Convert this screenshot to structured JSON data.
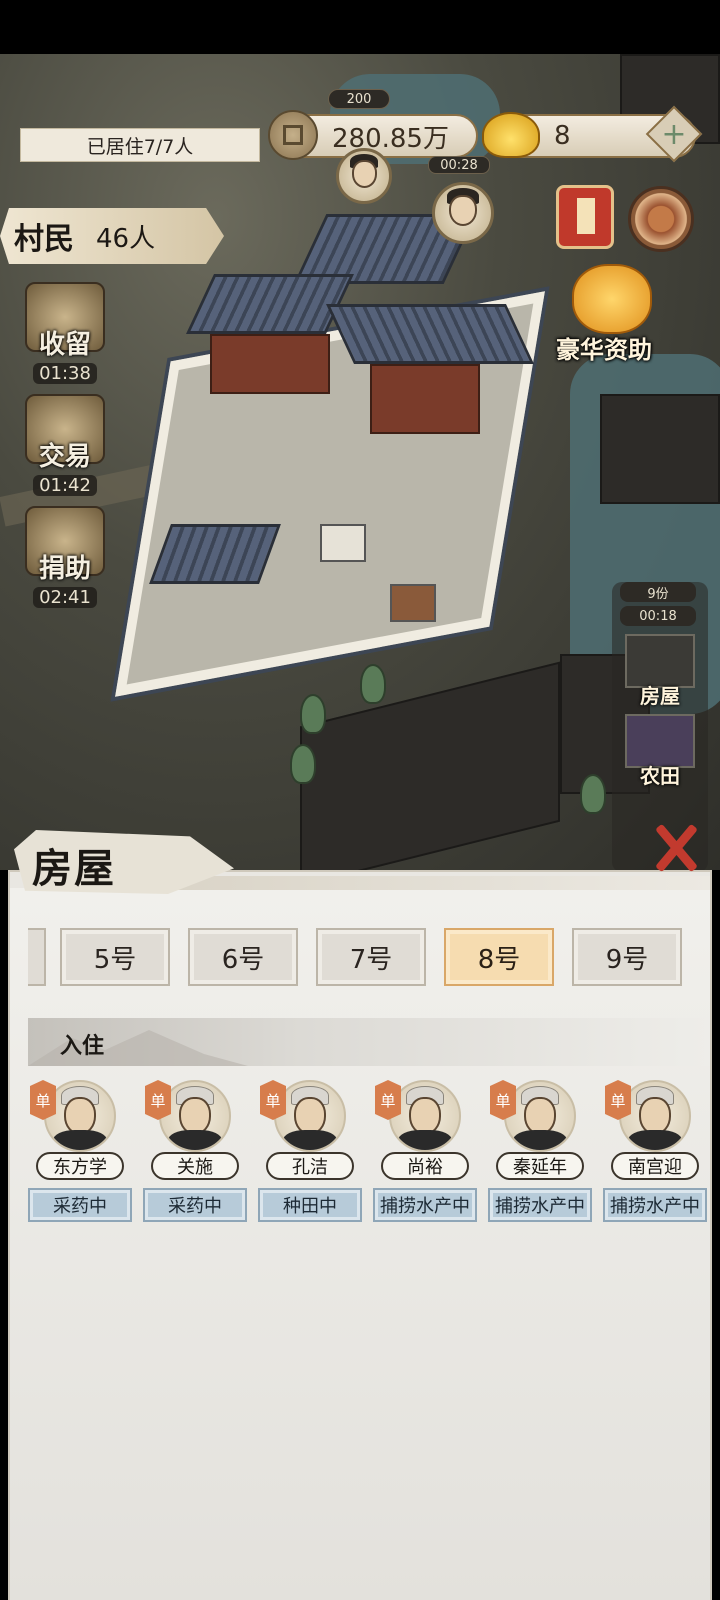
{
  "hud": {
    "residency": "已居住7/7人",
    "coins": "280.85万",
    "ingots": "8",
    "plus_label": "+",
    "top_badge": "200",
    "timer_top": "00:28",
    "villager_title": "村民",
    "villager_count": "46人"
  },
  "side_actions": [
    {
      "label": "收留",
      "timer": "01:38"
    },
    {
      "label": "交易",
      "timer": "01:42"
    },
    {
      "label": "捐助",
      "timer": "02:41"
    }
  ],
  "luxury": {
    "label": "豪华资助"
  },
  "right_panel": {
    "badge_count": "9份",
    "badge_timer": "00:18",
    "items": [
      {
        "label": "房屋"
      },
      {
        "label": "农田"
      }
    ]
  },
  "panel": {
    "title": "房屋",
    "tabs": [
      {
        "label": "5号",
        "active": false
      },
      {
        "label": "6号",
        "active": false
      },
      {
        "label": "7号",
        "active": false
      },
      {
        "label": "8号",
        "active": true
      },
      {
        "label": "9号",
        "active": false
      }
    ],
    "section_title": "入住",
    "residents": [
      {
        "tag": "单",
        "name": "东方学",
        "status": "采药中"
      },
      {
        "tag": "单",
        "name": "关施",
        "status": "采药中"
      },
      {
        "tag": "单",
        "name": "孔洁",
        "status": "种田中"
      },
      {
        "tag": "单",
        "name": "尚裕",
        "status": "捕捞水产中"
      },
      {
        "tag": "单",
        "name": "秦延年",
        "status": "捕捞水产中"
      },
      {
        "tag": "单",
        "name": "南宫迎",
        "status": "捕捞水产中"
      }
    ]
  },
  "colors": {
    "active_tab": "#f6dcb0",
    "status_chip": "#b7cbd9",
    "close_x": "#c23a2e"
  }
}
